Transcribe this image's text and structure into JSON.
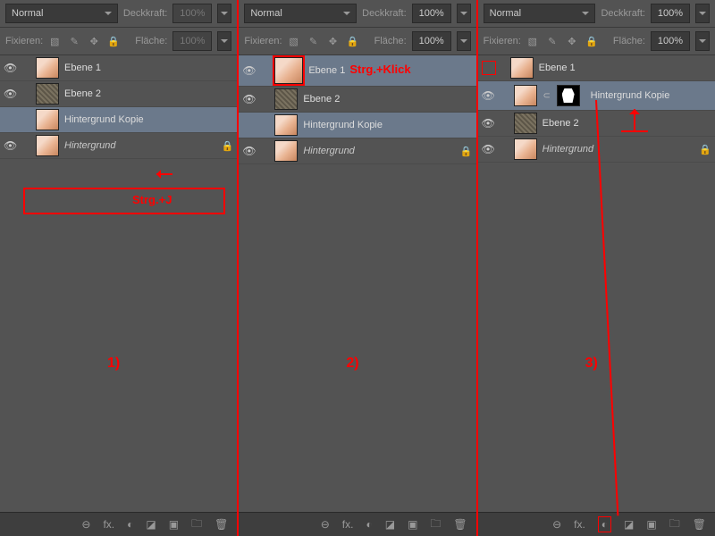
{
  "blend_mode": "Normal",
  "opacity_label": "Deckkraft:",
  "fill_label": "Fläche:",
  "lock_label": "Fixieren:",
  "pct_100": "100%",
  "layers_common": {
    "ebene1": "Ebene 1",
    "ebene2": "Ebene 2",
    "bgcopy": "Hintergrund Kopie",
    "bg": "Hintergrund"
  },
  "annotations": {
    "strg_j": "Strg.+J",
    "strg_klick": "Strg.+Klick",
    "step1": "1)",
    "step2": "2)",
    "step3": "3)"
  },
  "footer_icons": [
    "⊖",
    "fx.",
    "◐",
    "◪",
    "▣",
    "🗀",
    "🗑"
  ]
}
